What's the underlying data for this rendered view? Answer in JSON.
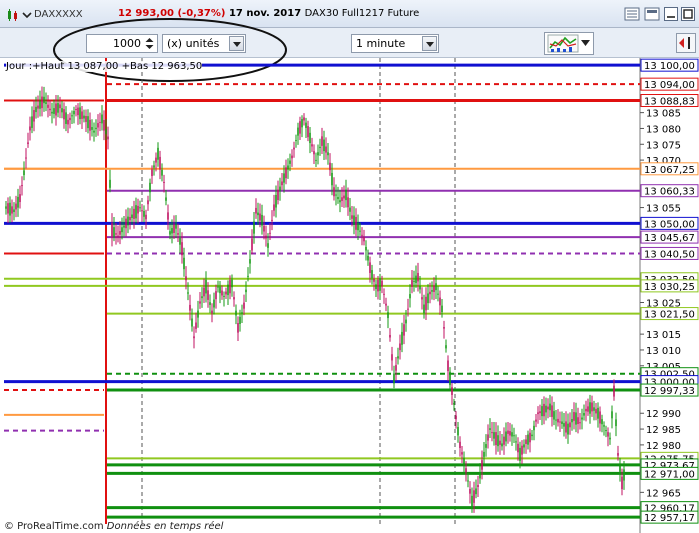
{
  "window": {
    "symbol": "DAXXXXX",
    "price": "12 993,00",
    "change": "(-0,37%)",
    "date": "17 nov. 2017",
    "instrument": "DAX30 Full1217 Future"
  },
  "toolbar": {
    "quantity_value": "1000",
    "quantity_unit": "(x) unités",
    "timeframe": "1 minute"
  },
  "legend": {
    "text": "Jour :+Haut 13 087,00 +Bas 12 963,50"
  },
  "footer": {
    "brand": "© ProRealTime.com",
    "realtime": "Données en temps réel"
  },
  "chart_data": {
    "type": "candlestick",
    "ylim": [
      12955,
      13101
    ],
    "y_ticks": [
      {
        "v": 13085,
        "label": "13 085"
      },
      {
        "v": 13080,
        "label": "13 080"
      },
      {
        "v": 13075,
        "label": "13 075"
      },
      {
        "v": 13070,
        "label": "13 070"
      },
      {
        "v": 13055,
        "label": "13 055"
      },
      {
        "v": 13025,
        "label": "13 025"
      },
      {
        "v": 13015,
        "label": "13 015"
      },
      {
        "v": 13010,
        "label": "13 010"
      },
      {
        "v": 13005,
        "label": "13 005"
      },
      {
        "v": 12990,
        "label": "12 990"
      },
      {
        "v": 12985,
        "label": "12 985"
      },
      {
        "v": 12980,
        "label": "12 980"
      },
      {
        "v": 12965,
        "label": "12 965"
      }
    ],
    "levels": [
      {
        "v": 13100.0,
        "label": "13 100,00",
        "color": "#1010d0",
        "style": "solid"
      },
      {
        "v": 13094.0,
        "label": "13 094,00",
        "color": "#e01010",
        "style": "dashed"
      },
      {
        "v": 13088.83,
        "label": "13 088,83",
        "color": "#e01010",
        "style": "solid"
      },
      {
        "v": 13067.25,
        "label": "13 067,25",
        "color": "#ff9a40",
        "style": "solid"
      },
      {
        "v": 13060.33,
        "label": "13 060,33",
        "color": "#9030b0",
        "style": "solid"
      },
      {
        "v": 13050.0,
        "label": "13 050,00",
        "color": "#1010d0",
        "style": "solid"
      },
      {
        "v": 13045.67,
        "label": "13 045,67",
        "color": "#9030b0",
        "style": "solid"
      },
      {
        "v": 13040.5,
        "label": "13 040,50",
        "color": "#9030b0",
        "style": "dashed"
      },
      {
        "v": 13032.5,
        "label": "13 032,50",
        "color": "#90c820",
        "style": "solid"
      },
      {
        "v": 13030.25,
        "label": "13 030,25",
        "color": "#90c820",
        "style": "solid"
      },
      {
        "v": 13021.5,
        "label": "13 021,50",
        "color": "#90c820",
        "style": "solid"
      },
      {
        "v": 13002.5,
        "label": "13 002,50",
        "color": "#109010",
        "style": "dashed"
      },
      {
        "v": 13000.0,
        "label": "13 000,00",
        "color": "#1010d0",
        "style": "solid"
      },
      {
        "v": 12997.33,
        "label": "12 997,33",
        "color": "#109010",
        "style": "solid"
      },
      {
        "v": 12975.75,
        "label": "12 975,75",
        "color": "#90c820",
        "style": "solid"
      },
      {
        "v": 12973.67,
        "label": "12 973,67",
        "color": "#109010",
        "style": "solid"
      },
      {
        "v": 12971.0,
        "label": "12 971,00",
        "color": "#109010",
        "style": "solid"
      },
      {
        "v": 12960.17,
        "label": "12 960,17",
        "color": "#109010",
        "style": "solid"
      },
      {
        "v": 12957.17,
        "label": "12 957,17",
        "color": "#109010",
        "style": "solid"
      }
    ],
    "previous_day_levels": [
      {
        "v": 13088.83,
        "color": "#e01010",
        "style": "solid"
      },
      {
        "v": 13067.25,
        "color": "#ff9a40",
        "style": "solid"
      },
      {
        "v": 13040.5,
        "color": "#e01010",
        "style": "solid"
      },
      {
        "v": 13000.0,
        "color": "#1010d0",
        "style": "solid"
      },
      {
        "v": 12997.33,
        "color": "#e01010",
        "style": "dashed"
      },
      {
        "v": 12989.5,
        "color": "#ff9a40",
        "style": "solid"
      },
      {
        "v": 12984.5,
        "color": "#9030b0",
        "style": "dashed"
      }
    ],
    "price_path": [
      [
        0,
        13055
      ],
      [
        8,
        13054
      ],
      [
        14,
        13058
      ],
      [
        18,
        13066
      ],
      [
        24,
        13080
      ],
      [
        30,
        13086
      ],
      [
        38,
        13089
      ],
      [
        46,
        13085
      ],
      [
        54,
        13087
      ],
      [
        62,
        13082
      ],
      [
        70,
        13086
      ],
      [
        80,
        13083
      ],
      [
        88,
        13079
      ],
      [
        96,
        13083
      ],
      [
        102,
        13077
      ],
      [
        106,
        13048
      ],
      [
        112,
        13046
      ],
      [
        120,
        13050
      ],
      [
        128,
        13053
      ],
      [
        134,
        13055
      ],
      [
        140,
        13052
      ],
      [
        146,
        13066
      ],
      [
        152,
        13072
      ],
      [
        158,
        13063
      ],
      [
        164,
        13047
      ],
      [
        170,
        13049
      ],
      [
        176,
        13042
      ],
      [
        182,
        13028
      ],
      [
        188,
        13014
      ],
      [
        194,
        13025
      ],
      [
        200,
        13030
      ],
      [
        206,
        13022
      ],
      [
        212,
        13030
      ],
      [
        218,
        13027
      ],
      [
        226,
        13031
      ],
      [
        232,
        13017
      ],
      [
        238,
        13024
      ],
      [
        244,
        13038
      ],
      [
        250,
        13054
      ],
      [
        256,
        13051
      ],
      [
        262,
        13043
      ],
      [
        268,
        13055
      ],
      [
        274,
        13061
      ],
      [
        280,
        13066
      ],
      [
        286,
        13071
      ],
      [
        292,
        13079
      ],
      [
        298,
        13083
      ],
      [
        304,
        13077
      ],
      [
        310,
        13070
      ],
      [
        316,
        13076
      ],
      [
        322,
        13072
      ],
      [
        328,
        13060
      ],
      [
        334,
        13057
      ],
      [
        340,
        13059
      ],
      [
        346,
        13052
      ],
      [
        352,
        13049
      ],
      [
        358,
        13045
      ],
      [
        364,
        13036
      ],
      [
        370,
        13030
      ],
      [
        376,
        13031
      ],
      [
        382,
        13021
      ],
      [
        388,
        13001
      ],
      [
        394,
        13011
      ],
      [
        400,
        13019
      ],
      [
        406,
        13031
      ],
      [
        412,
        13033
      ],
      [
        418,
        13023
      ],
      [
        424,
        13028
      ],
      [
        430,
        13030
      ],
      [
        436,
        13023
      ],
      [
        442,
        13005
      ],
      [
        448,
        12993
      ],
      [
        454,
        12980
      ],
      [
        460,
        12972
      ],
      [
        466,
        12962
      ],
      [
        472,
        12967
      ],
      [
        478,
        12977
      ],
      [
        484,
        12985
      ],
      [
        490,
        12982
      ],
      [
        496,
        12980
      ],
      [
        502,
        12984
      ],
      [
        508,
        12983
      ],
      [
        514,
        12977
      ],
      [
        520,
        12981
      ],
      [
        526,
        12983
      ],
      [
        532,
        12990
      ],
      [
        538,
        12991
      ],
      [
        544,
        12992
      ],
      [
        550,
        12988
      ],
      [
        556,
        12987
      ],
      [
        562,
        12985
      ],
      [
        568,
        12989
      ],
      [
        574,
        12987
      ],
      [
        580,
        12991
      ],
      [
        586,
        12992
      ],
      [
        592,
        12990
      ],
      [
        598,
        12986
      ],
      [
        604,
        12982
      ],
      [
        608,
        12997
      ],
      [
        612,
        12977
      ],
      [
        616,
        12968
      ],
      [
        620,
        12973
      ]
    ]
  }
}
